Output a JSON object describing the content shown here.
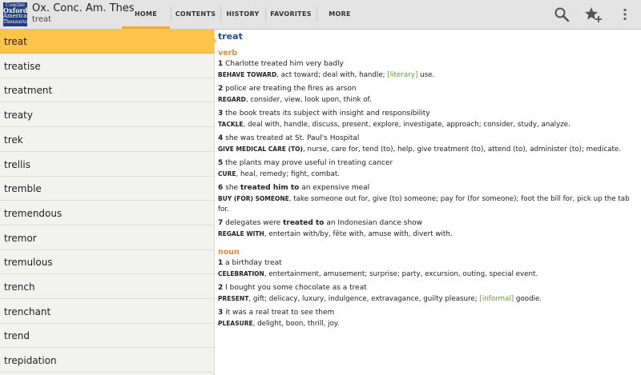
{
  "app": {
    "title": "Ox. Conc. Am. Thes",
    "subtitle": "treat",
    "icon_lines": [
      "Concise",
      "Oxford",
      "American",
      "Thesaurus"
    ]
  },
  "tabs": [
    {
      "label": "HOME",
      "active": true
    },
    {
      "label": "CONTENTS",
      "active": false
    },
    {
      "label": "HISTORY",
      "active": false
    },
    {
      "label": "FAVORITES",
      "active": false
    },
    {
      "label": "MORE",
      "active": false
    }
  ],
  "actions": [
    "search-icon",
    "add-favorite-icon",
    "overflow-menu-icon"
  ],
  "word_list": [
    "treat",
    "treatise",
    "treatment",
    "treaty",
    "trek",
    "trellis",
    "tremble",
    "tremendous",
    "tremor",
    "tremulous",
    "trench",
    "trenchant",
    "trend",
    "trepidation"
  ],
  "entry": {
    "headword": "treat",
    "verb_label": "verb",
    "noun_label": "noun",
    "verb": [
      {
        "n": "1",
        "a": "Charlotte treated him very badly",
        "bold": "",
        "b": "",
        "head": "BEHAVE TOWARD",
        "syn": ", act toward; deal with, handle; ",
        "reg": "[literary]",
        "tail": " use."
      },
      {
        "n": "2",
        "a": "police are treating the fires as arson",
        "bold": "",
        "b": "",
        "head": "REGARD",
        "syn": ", consider, view, look upon, think of.",
        "reg": "",
        "tail": ""
      },
      {
        "n": "3",
        "a": "the book treats its subject with insight and responsibility",
        "bold": "",
        "b": "",
        "head": "TACKLE",
        "syn": ", deal with, handle, discuss, present, explore, investigate, approach; consider, study, analyze.",
        "reg": "",
        "tail": ""
      },
      {
        "n": "4",
        "a": "she was treated at St. Paul's Hospital",
        "bold": "",
        "b": "",
        "head": "GIVE MEDICAL CARE (TO)",
        "syn": ", nurse, care for, tend (to), help, give treatment (to), attend (to), administer (to); medicate.",
        "reg": "",
        "tail": ""
      },
      {
        "n": "5",
        "a": "the plants may prove useful in treating cancer",
        "bold": "",
        "b": "",
        "head": "CURE",
        "syn": ", heal, remedy; fight, combat.",
        "reg": "",
        "tail": ""
      },
      {
        "n": "6",
        "a": "she ",
        "bold": "treated him to",
        "b": " an expensive meal",
        "head": "BUY (FOR) SOMEONE",
        "syn": ", take someone out for, give (to) someone; pay for (for someone); foot the bill for, pick up the tab for.",
        "reg": "",
        "tail": ""
      },
      {
        "n": "7",
        "a": "delegates were ",
        "bold": "treated to",
        "b": " an Indonesian dance show",
        "head": "REGALE WITH",
        "syn": ", entertain with/by, fête with, amuse with, divert with.",
        "reg": "",
        "tail": ""
      }
    ],
    "noun": [
      {
        "n": "1",
        "a": "a birthday treat",
        "bold": "",
        "b": "",
        "head": "CELEBRATION",
        "syn": ", entertainment, amusement; surprise; party, excursion, outing, special event.",
        "reg": "",
        "tail": ""
      },
      {
        "n": "2",
        "a": "I bought you some chocolate as a treat",
        "bold": "",
        "b": "",
        "head": "PRESENT",
        "syn": ", gift; delicacy, luxury, indulgence, extravagance, guilty pleasure; ",
        "reg": "[informal]",
        "tail": " goodie."
      },
      {
        "n": "3",
        "a": "it was a real treat to see them",
        "bold": "",
        "b": "",
        "head": "PLEASURE",
        "syn": ", delight, boon, thrill, joy.",
        "reg": "",
        "tail": ""
      }
    ]
  },
  "colors": {
    "accent": "#fdc44c",
    "headword": "#1e4e8c",
    "pos": "#e8883a",
    "register": "#6a9a3c"
  }
}
